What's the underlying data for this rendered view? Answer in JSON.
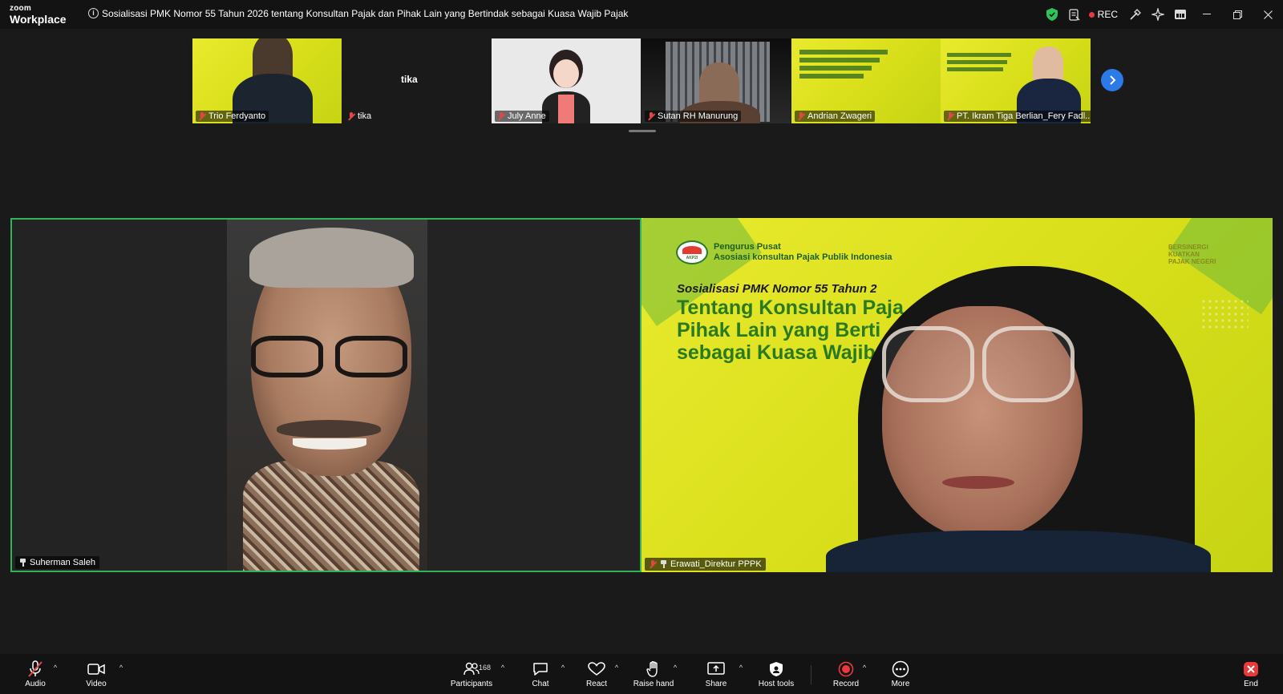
{
  "window": {
    "brand_small": "zoom",
    "brand_large": "Workplace",
    "meeting_title": "Sosialisasi PMK Nomor 55 Tahun 2026 tentang Konsultan Pajak dan Pihak Lain yang Bertindak sebagai Kuasa Wajib Pajak",
    "rec_label": "REC"
  },
  "thumbnails": [
    {
      "name": "Trio Ferdyanto",
      "muted": true
    },
    {
      "name": "tika",
      "muted": true,
      "center_label": "tika"
    },
    {
      "name": "July Anne",
      "muted": true
    },
    {
      "name": "Sutan RH Manurung",
      "muted": true
    },
    {
      "name": "Andrian Zwageri",
      "muted": true
    },
    {
      "name": "PT. Ikram Tiga Berlian_Fery Fadl...",
      "muted": true
    }
  ],
  "main_tiles": {
    "left": {
      "name": "Suherman Saleh",
      "pinned": true,
      "active_speaker": true
    },
    "right": {
      "name": "Erawati_Direktur PPPK",
      "pinned": true,
      "muted": true,
      "slide": {
        "org_line1": "Pengurus Pusat",
        "org_line2": "Asosiasi konsultan Pajak Publik Indonesia",
        "heading": "Sosialisasi PMK Nomor 55 Tahun 2",
        "line1": "Tentang Konsultan Paja",
        "line2": "Pihak Lain yang Berti",
        "line3": "sebagai Kuasa Wajib",
        "logo_text": "AKP2I",
        "corner_line1": "BERSINERGI",
        "corner_line2": "KUATKAN",
        "corner_line3": "PAJAK NEGERI"
      }
    }
  },
  "toolbar": {
    "audio": "Audio",
    "video": "Video",
    "participants": "Participants",
    "participants_count": "168",
    "chat": "Chat",
    "react": "React",
    "raise_hand": "Raise hand",
    "share": "Share",
    "host_tools": "Host tools",
    "record": "Record",
    "more": "More",
    "end": "End"
  },
  "colors": {
    "accent_green": "#2fb45a",
    "slide_yellow": "#e0e31c",
    "mute_red": "#e04848",
    "record_red": "#e8393b",
    "link_blue": "#2b7ae8"
  }
}
